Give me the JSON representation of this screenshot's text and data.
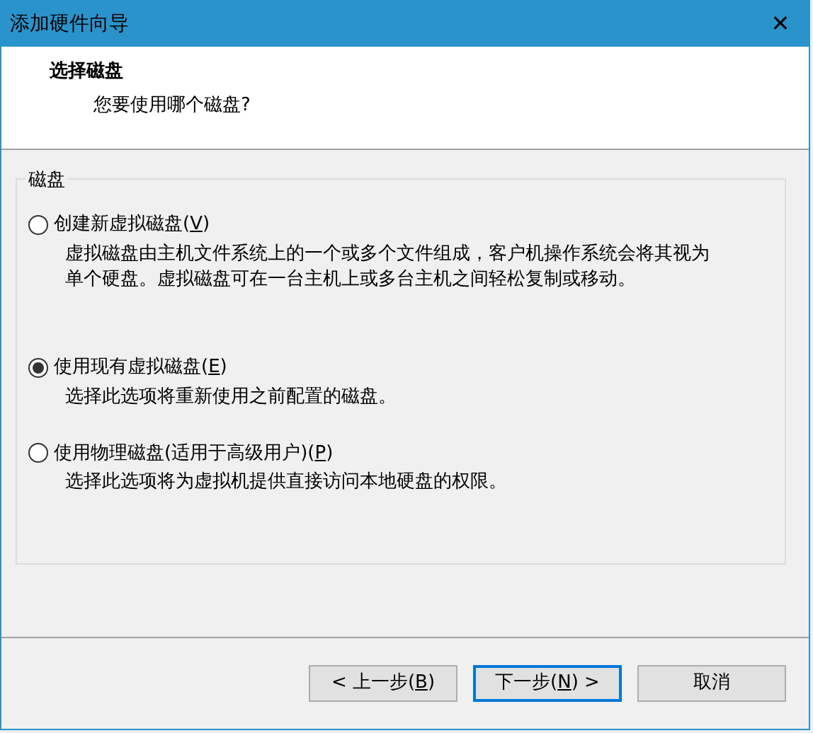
{
  "window": {
    "title": "添加硬件向导",
    "close": "✕"
  },
  "header": {
    "title": "选择磁盘",
    "subtitle": "您要使用哪个磁盘?"
  },
  "group": {
    "title": "磁盘",
    "options": [
      {
        "label_before": "创建新虚拟磁盘(",
        "key": "V",
        "label_after": ")",
        "selected": false,
        "description": "虚拟磁盘由主机文件系统上的一个或多个文件组成，客户机操作系统会将其视为单个硬盘。虚拟磁盘可在一台主机上或多台主机之间轻松复制或移动。"
      },
      {
        "label_before": "使用现有虚拟磁盘(",
        "key": "E",
        "label_after": ")",
        "selected": true,
        "description": "选择此选项将重新使用之前配置的磁盘。"
      },
      {
        "label_before": "使用物理磁盘(适用于高级用户)(",
        "key": "P",
        "label_after": ")",
        "selected": false,
        "description": "选择此选项将为虚拟机提供直接访问本地硬盘的权限。"
      }
    ]
  },
  "buttons": [
    {
      "label_before": "< 上一步(",
      "key": "B",
      "label_after": ")",
      "default": false
    },
    {
      "label_before": "下一步(",
      "key": "N",
      "label_after": ") >",
      "default": true
    },
    {
      "label_before": "取消",
      "default": false
    }
  ]
}
